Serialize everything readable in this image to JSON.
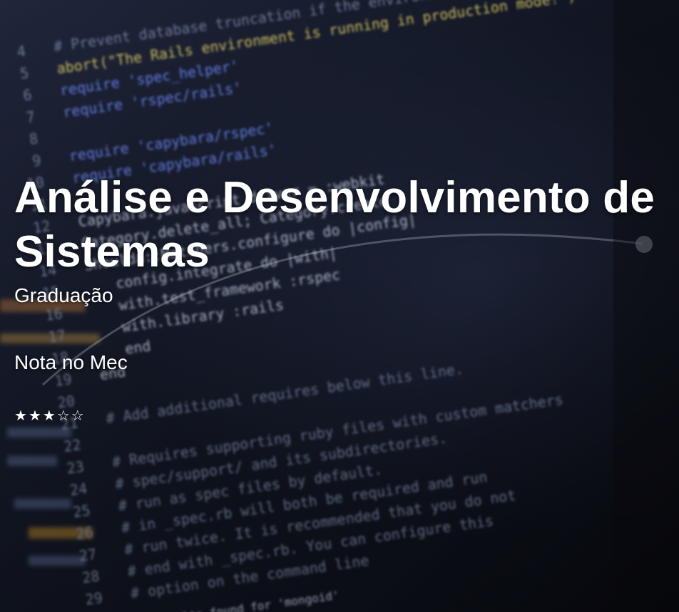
{
  "hero": {
    "title": "Análise e Desenvolvimento de Sistemas",
    "level": "Graduação",
    "mec_label": "Nota no Mec",
    "rating": {
      "value": 3,
      "max": 5
    }
  },
  "background_code": {
    "lines": [
      {
        "num": "4",
        "text": "# Prevent database truncation if the environment"
      },
      {
        "num": "5",
        "text": "abort(\"The Rails environment is running in production mode!\")"
      },
      {
        "num": "6",
        "text": "require 'spec_helper'"
      },
      {
        "num": "7",
        "text": "require 'rspec/rails'"
      },
      {
        "num": "8",
        "text": ""
      },
      {
        "num": "9",
        "text": "require 'capybara/rspec'"
      },
      {
        "num": "10",
        "text": "require 'capybara/rails'"
      },
      {
        "num": "11",
        "text": ""
      },
      {
        "num": "12",
        "text": "Capybara.javascript_driver = :webkit"
      },
      {
        "num": "13",
        "text": "Category.delete_all; Category.create"
      },
      {
        "num": "14",
        "text": "Shoulda::Matchers.configure do |config|"
      },
      {
        "num": "15",
        "text": "  config.integrate do |with|"
      },
      {
        "num": "16",
        "text": "    with.test_framework :rspec"
      },
      {
        "num": "17",
        "text": "    with.library :rails"
      },
      {
        "num": "18",
        "text": "  end"
      },
      {
        "num": "19",
        "text": "end"
      },
      {
        "num": "20",
        "text": ""
      },
      {
        "num": "21",
        "text": "# Add additional requires below this line."
      },
      {
        "num": "22",
        "text": ""
      },
      {
        "num": "23",
        "text": "# Requires supporting ruby files with custom matchers"
      },
      {
        "num": "24",
        "text": "# spec/support/ and its subdirectories."
      },
      {
        "num": "25",
        "text": "# run as spec files by default."
      },
      {
        "num": "26",
        "text": "# in _spec.rb will both be required and run"
      },
      {
        "num": "27",
        "text": "# run twice. It is recommended that you do not"
      },
      {
        "num": "28",
        "text": "# end with _spec.rb. You can configure this"
      },
      {
        "num": "29",
        "text": "# option on the command line"
      }
    ],
    "footer_text": "No results found for 'mongoid'",
    "colors": {
      "keyword": "#6f8cff",
      "string": "#e6d36a",
      "comment": "#7b86a8",
      "linenum": "#7f8aa8",
      "plain": "#c9d2ea"
    }
  }
}
